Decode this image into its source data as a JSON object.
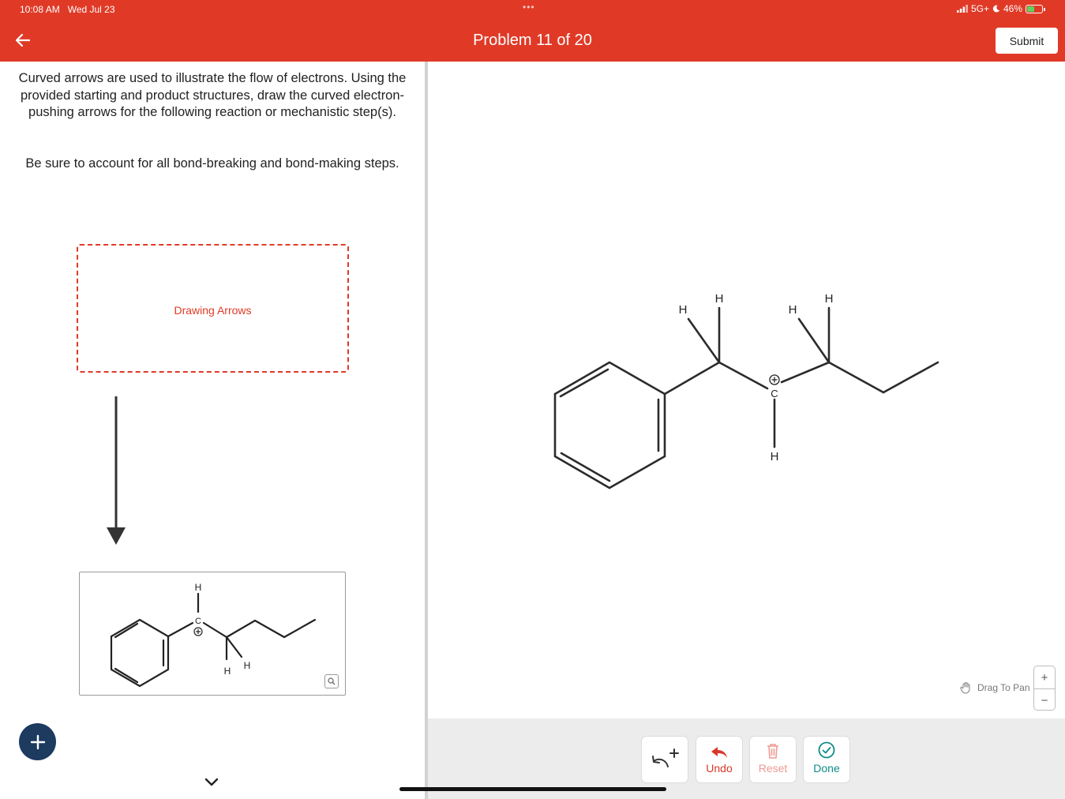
{
  "status_bar": {
    "time": "10:08 AM",
    "date": "Wed Jul 23",
    "network": "5G+",
    "battery": "46%",
    "battery_level": 0.46,
    "icons": [
      "signal-icon",
      "moon-icon",
      "battery-charging-icon"
    ]
  },
  "header": {
    "title": "Problem 11 of 20",
    "submit_label": "Submit",
    "back_icon": "arrow-left-icon",
    "colors": {
      "brand": "#e03a27",
      "text": "#ffffff"
    }
  },
  "question": {
    "paragraph1": "Curved arrows are used to illustrate the flow of electrons. Using the provided starting and product structures, draw the curved electron-pushing arrows for the following reaction or mechanistic step(s).",
    "paragraph2": "Be sure to account for all bond-breaking and bond-making steps.",
    "drop_zone_label": "Drawing Arrows",
    "product_atoms": [
      "H",
      "C",
      "H",
      "H"
    ],
    "zoom_icon": "magnifier-icon"
  },
  "canvas": {
    "atoms": [
      "H",
      "H",
      "H",
      "H",
      "C",
      "H"
    ],
    "charge": "+",
    "drag_hint": "Drag To Pan",
    "zoom_in": "+",
    "zoom_out": "−"
  },
  "toolbar": {
    "arrow_tool_icon": "curved-arrow-plus-icon",
    "undo_label": "Undo",
    "reset_label": "Reset",
    "done_label": "Done",
    "colors": {
      "undo": "#d9372a",
      "reset": "#ef9a93",
      "done": "#0f8c88"
    }
  },
  "fab_icon": "plus-icon"
}
